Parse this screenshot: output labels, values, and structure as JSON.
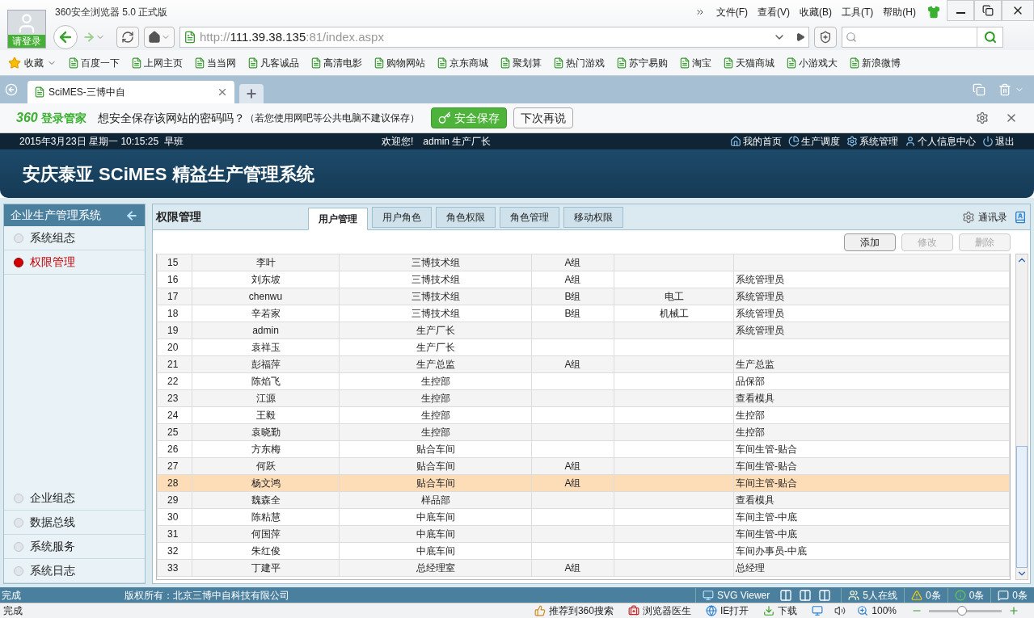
{
  "browser": {
    "user": "请登录",
    "title": "360安全浏览器 5.0 正式版",
    "menu": [
      "文件(F)",
      "查看(V)",
      "收藏(B)",
      "工具(T)",
      "帮助(H)"
    ],
    "url_host": "http://",
    "url_main": "111.39.38.135",
    "url_rest": ":81/index.aspx",
    "bookmarks_label": "收藏",
    "bookmarks": [
      "百度一下",
      "上网主页",
      "当当网",
      "凡客诚品",
      "高清电影",
      "购物网站",
      "京东商城",
      "聚划算",
      "热门游戏",
      "苏宁易购",
      "淘宝",
      "天猫商城",
      "小游戏大",
      "新浪微博"
    ],
    "tabs": [
      {
        "label": "SciMES-三博中自",
        "selected": true
      }
    ],
    "password_bar": {
      "brand": "360",
      "product": "登录管家",
      "question": "想安全保存该网站的密码吗？",
      "hint": "（若您使用网吧等公共电脑不建议保存）",
      "save": "安全保存",
      "later": "下次再说"
    }
  },
  "app": {
    "datetime": "2015年3月23日 星期一 10:15:25  早班",
    "welcome": "欢迎您!",
    "user": "admin 生产厂长",
    "top_links": [
      {
        "kind": "home",
        "label": "我的首页"
      },
      {
        "kind": "chart",
        "label": "生产调度"
      },
      {
        "kind": "gear",
        "label": "系统管理"
      },
      {
        "kind": "user",
        "label": "个人信息中心"
      },
      {
        "kind": "power",
        "label": "退出"
      }
    ],
    "title": "安庆泰亚 SCiMES 精益生产管理系统",
    "sidebar": {
      "title": "企业生产管理系统",
      "items": [
        {
          "label": "系统组态",
          "selected": false
        },
        {
          "label": "权限管理",
          "selected": true
        }
      ],
      "bottom_items": [
        {
          "label": "企业组态",
          "selected": false
        },
        {
          "label": "数据总线",
          "selected": false
        },
        {
          "label": "系统服务",
          "selected": false
        },
        {
          "label": "系统日志",
          "selected": false
        }
      ]
    },
    "panel_title": "权限管理",
    "tabs": [
      {
        "label": "用户管理",
        "selected": true
      },
      {
        "label": "用户角色",
        "selected": false
      },
      {
        "label": "角色权限",
        "selected": false
      },
      {
        "label": "角色管理",
        "selected": false
      },
      {
        "label": "移动权限",
        "selected": false
      }
    ],
    "contacts": "通讯录",
    "buttons": [
      {
        "label": "添加",
        "disabled": false
      },
      {
        "label": "修改",
        "disabled": true
      },
      {
        "label": "删除",
        "disabled": true
      }
    ],
    "rows": [
      {
        "no": "15",
        "name": "李叶",
        "dept": "三博技术组",
        "group": "A组",
        "selected": false
      },
      {
        "no": "16",
        "name": "刘东坡",
        "dept": "三博技术组",
        "group": "A组",
        "role": "系统管理员",
        "selected": false
      },
      {
        "no": "17",
        "name": "chenwu",
        "dept": "三博技术组",
        "group": "B组",
        "work": "电工",
        "role": "系统管理员",
        "selected": false
      },
      {
        "no": "18",
        "name": "辛若家",
        "dept": "三博技术组",
        "group": "B组",
        "work": "机械工",
        "role": "系统管理员",
        "selected": false
      },
      {
        "no": "19",
        "name": "admin",
        "dept": "生产厂长",
        "role": "系统管理员",
        "selected": false
      },
      {
        "no": "20",
        "name": "袁祥玉",
        "dept": "生产厂长",
        "selected": false
      },
      {
        "no": "21",
        "name": "彭福萍",
        "dept": "生产总监",
        "group": "A组",
        "role": "生产总监",
        "selected": false
      },
      {
        "no": "22",
        "name": "陈焰飞",
        "dept": "生控部",
        "role": "品保部",
        "selected": false
      },
      {
        "no": "23",
        "name": "江源",
        "dept": "生控部",
        "role": "查看模具",
        "selected": false
      },
      {
        "no": "24",
        "name": "王毅",
        "dept": "生控部",
        "role": "生控部",
        "selected": false
      },
      {
        "no": "25",
        "name": "袁晓勤",
        "dept": "生控部",
        "role": "生控部",
        "selected": false
      },
      {
        "no": "26",
        "name": "方东梅",
        "dept": "贴合车间",
        "role": "车间生管-贴合",
        "selected": false
      },
      {
        "no": "27",
        "name": "何跃",
        "dept": "贴合车间",
        "group": "A组",
        "role": "车间生管-贴合",
        "selected": false
      },
      {
        "no": "28",
        "name": "杨文鸿",
        "dept": "贴合车间",
        "group": "A组",
        "role": "车间主管-贴合",
        "selected": true
      },
      {
        "no": "29",
        "name": "魏森全",
        "dept": "样品部",
        "role": "查看模具",
        "selected": false
      },
      {
        "no": "30",
        "name": "陈粘慧",
        "dept": "中底车间",
        "role": "车间主管-中底",
        "selected": false
      },
      {
        "no": "31",
        "name": "何国萍",
        "dept": "中底车间",
        "role": "车间生管-中底",
        "selected": false
      },
      {
        "no": "32",
        "name": "朱红俊",
        "dept": "中底车间",
        "role": "车间办事员-中底",
        "selected": false
      },
      {
        "no": "33",
        "name": "丁建平",
        "dept": "总经理室",
        "group": "A组",
        "role": "总经理",
        "selected": false
      }
    ],
    "footer": {
      "status": "完成",
      "copyright": "版权所有：北京三博中自科技有限公司",
      "svg": "SVG Viewer",
      "online": "5人在线",
      "warnings": "0条",
      "infos": "0条",
      "messages": "0条"
    }
  },
  "status_bar": {
    "status": "完成",
    "items": [
      {
        "kind": "thumb",
        "label": "推荐到360搜索"
      },
      {
        "kind": "doctor",
        "label": "浏览器医生"
      },
      {
        "kind": "ie",
        "label": "IE打开"
      },
      {
        "kind": "download",
        "label": "下载"
      }
    ],
    "zoom": "100%",
    "zoom_slider": {
      "level": 0.45
    }
  }
}
